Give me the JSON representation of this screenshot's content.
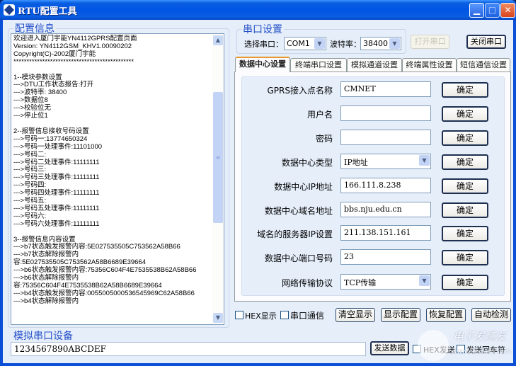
{
  "window": {
    "title": "RTU配置工具",
    "min_icon": "▁",
    "max_icon": "□",
    "close_icon": "✕"
  },
  "config_info": {
    "group_title": "配置信息",
    "log_text": "欢迎进入厦门宇能YN4112GPRS配置页面\nVersion: YN4112GSM_KHV1.00090202\nCopyright(C)-2002厦门宇能\n**********************************************\n\n1--模块参数设置\n--->DTU工作状态报告:打开\n--->波特率: 38400\n--->数据位8\n--->校验位无\n--->停止位1\n\n2--报警信息接收号码设置\n--->号码一:13774650324\n--->号码一处理事件:11101000\n--->号码二:\n--->号码二处理事件:11111111\n--->号码三:\n--->号码三处理事件:11111111\n--->号码四:\n--->号码四处理事件:11111111\n--->号码五:\n--->号码五处理事件:11111111\n--->号码六:\n--->号码六处理事件:11111111\n\n3--报警信息内容设置\n--->b7状态触发报警内容:5E027535505C753562A58B66\n--->b7状态解除报警内\n容:5E027535505C753562A58B6689E39664\n--->b6状态触发报警内容:75356C604F4E7535538B62A58B66\n--->b6状态解除报警内\n容:75356C604F4E7535538B62A58B6689E39664\n--->b4状态触发报警内容:0055005000536545969C62A58B66\n--->b4状态解除报警内",
    "scroll_up_icon": "▲",
    "scroll_down_icon": "▼",
    "scroll_grip_icon": "≡"
  },
  "sim_serial": {
    "group_title": "模拟串口设备",
    "input_value": "1234567890ABCDEF",
    "send_button": "发送数据",
    "hex_send_label": "HEX发送",
    "send_cr_label": "发送回车符"
  },
  "serial_settings": {
    "group_title": "串口设置",
    "port_label": "选择串口：",
    "port_value": "COM1",
    "baud_label": "波特率：",
    "baud_value": "38400",
    "open_button": "打开串口",
    "close_button": "关闭串口",
    "dropdown_icon": "▼"
  },
  "tabs": [
    {
      "label": "数据中心设置",
      "active": true
    },
    {
      "label": "终端串口设置",
      "active": false
    },
    {
      "label": "模拟通道设置",
      "active": false
    },
    {
      "label": "终端属性设置",
      "active": false
    },
    {
      "label": "短信通信设置",
      "active": false
    }
  ],
  "form": {
    "confirm_label": "确定",
    "fields": [
      {
        "label": "GPRS接入点名称",
        "value": "CMNET",
        "type": "text"
      },
      {
        "label": "用户名",
        "value": "",
        "type": "text"
      },
      {
        "label": "密码",
        "value": "",
        "type": "text"
      },
      {
        "label": "数据中心类型",
        "value": "IP地址",
        "type": "select"
      },
      {
        "label": "数据中心IP地址",
        "value": "166.111.8.238",
        "type": "text"
      },
      {
        "label": "数据中心域名地址",
        "value": "bbs.nju.edu.cn",
        "type": "text"
      },
      {
        "label": "域名的服务器IP设置",
        "value": "211.138.151.161",
        "type": "text"
      },
      {
        "label": "数据中心端口号码",
        "value": "23",
        "type": "text"
      },
      {
        "label": "网络传输协议",
        "value": "TCP传输",
        "type": "select"
      }
    ]
  },
  "bottom_bar": {
    "hex_display_label": "HEX显示",
    "serial_comm_label": "串口通信",
    "clear_button": "清空显示",
    "show_config_button": "显示配置",
    "restore_config_button": "恢复配置",
    "auto_detect_button": "自动检测"
  },
  "watermark": {
    "text": "电子发烧友",
    "url": "www.elecfans.com"
  }
}
